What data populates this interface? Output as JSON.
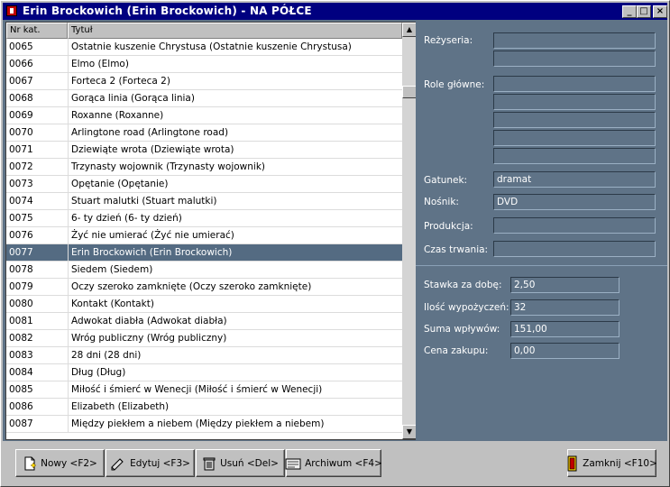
{
  "window": {
    "title": "Erin  Brockowich (Erin  Brockowich)  - NA PÓŁCE",
    "min_glyph": "_",
    "max_glyph": "□",
    "close_glyph": "×"
  },
  "table": {
    "columns": [
      "Nr kat.",
      "Tytuł"
    ],
    "rows": [
      {
        "nr": "0065",
        "title": "Ostatnie kuszenie Chrystusa (Ostatnie kuszenie Chrystusa)"
      },
      {
        "nr": "0066",
        "title": "Elmo (Elmo)"
      },
      {
        "nr": "0067",
        "title": "Forteca 2 (Forteca 2)"
      },
      {
        "nr": "0068",
        "title": "Gorąca linia (Gorąca linia)"
      },
      {
        "nr": "0069",
        "title": "Roxanne (Roxanne)"
      },
      {
        "nr": "0070",
        "title": "Arlingtone road (Arlingtone road)"
      },
      {
        "nr": "0071",
        "title": "Dziewiąte wrota (Dziewiąte wrota)"
      },
      {
        "nr": "0072",
        "title": "Trzynasty wojownik (Trzynasty wojownik)"
      },
      {
        "nr": "0073",
        "title": "Opętanie (Opętanie)"
      },
      {
        "nr": "0074",
        "title": "Stuart malutki (Stuart malutki)"
      },
      {
        "nr": "0075",
        "title": "6- ty dzień (6- ty dzień)"
      },
      {
        "nr": "0076",
        "title": "Żyć nie umierać (Żyć nie umierać)"
      },
      {
        "nr": "0077",
        "title": "Erin  Brockowich (Erin  Brockowich)",
        "selected": true
      },
      {
        "nr": "0078",
        "title": "Siedem (Siedem)"
      },
      {
        "nr": "0079",
        "title": "Oczy szeroko zamknięte (Oczy szeroko zamknięte)"
      },
      {
        "nr": "0080",
        "title": "Kontakt (Kontakt)"
      },
      {
        "nr": "0081",
        "title": "Adwokat  diabła (Adwokat  diabła)"
      },
      {
        "nr": "0082",
        "title": "Wróg publiczny (Wróg publiczny)"
      },
      {
        "nr": "0083",
        "title": "28  dni (28  dni)"
      },
      {
        "nr": "0084",
        "title": "Dług (Dług)"
      },
      {
        "nr": "0085",
        "title": "Miłość i śmierć w Wenecji (Miłość i śmierć w Wenecji)"
      },
      {
        "nr": "0086",
        "title": "Elizabeth (Elizabeth)"
      },
      {
        "nr": "0087",
        "title": "Między piekłem  a niebem (Między piekłem  a niebem)"
      }
    ]
  },
  "details": {
    "rezyseria_label": "Reżyseria:",
    "role_label": "Role główne:",
    "gatunek_label": "Gatunek:",
    "gatunek_value": "dramat",
    "nosnik_label": "Nośnik:",
    "nosnik_value": "DVD",
    "produkcja_label": "Produkcja:",
    "czas_label": "Czas trwania:",
    "stawka_label": "Stawka za dobę:",
    "stawka_value": "2,50",
    "ilosc_label": "Ilość wypożyczeń:",
    "ilosc_value": "32",
    "suma_label": "Suma wpływów:",
    "suma_value": "151,00",
    "cena_label": "Cena zakupu:",
    "cena_value": "0,00"
  },
  "buttons": {
    "nowy": "Nowy <F2>",
    "edytuj": "Edytuj <F3>",
    "usun": "Usuń <Del>",
    "archiwum": "Archiwum <F4>",
    "zamknij": "Zamknij <F10>"
  },
  "colors": {
    "titlebar": "#000080",
    "panel": "#5f7387",
    "selection": "#546b82"
  }
}
